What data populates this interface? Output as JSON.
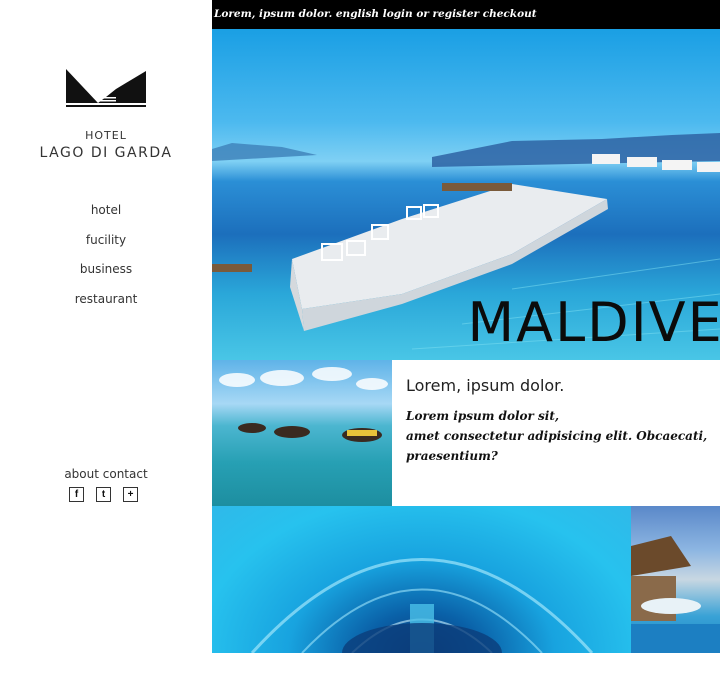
{
  "topbar": {
    "text": "Lorem, ipsum dolor. english login or register checkout"
  },
  "logo": {
    "line1": "HOTEL",
    "line2": "LAGO DI GARDA"
  },
  "nav": {
    "items": [
      {
        "label": "hotel"
      },
      {
        "label": "fucility"
      },
      {
        "label": "business"
      },
      {
        "label": "restaurant"
      }
    ]
  },
  "footer_links": {
    "about": "about",
    "contact": "contact"
  },
  "social": {
    "facebook": "f",
    "twitter": "t",
    "plus": "+"
  },
  "hero": {
    "title": "MALDIVES"
  },
  "feature": {
    "title": "Lorem, ipsum dolor.",
    "line1": "Lorem ipsum dolor sit,",
    "line2": "amet consectetur adipisicing elit. Obcaecati, praesentium?"
  },
  "colors": {
    "topbar_bg": "#000000",
    "text": "#333333",
    "water": "#2aa7d9"
  }
}
